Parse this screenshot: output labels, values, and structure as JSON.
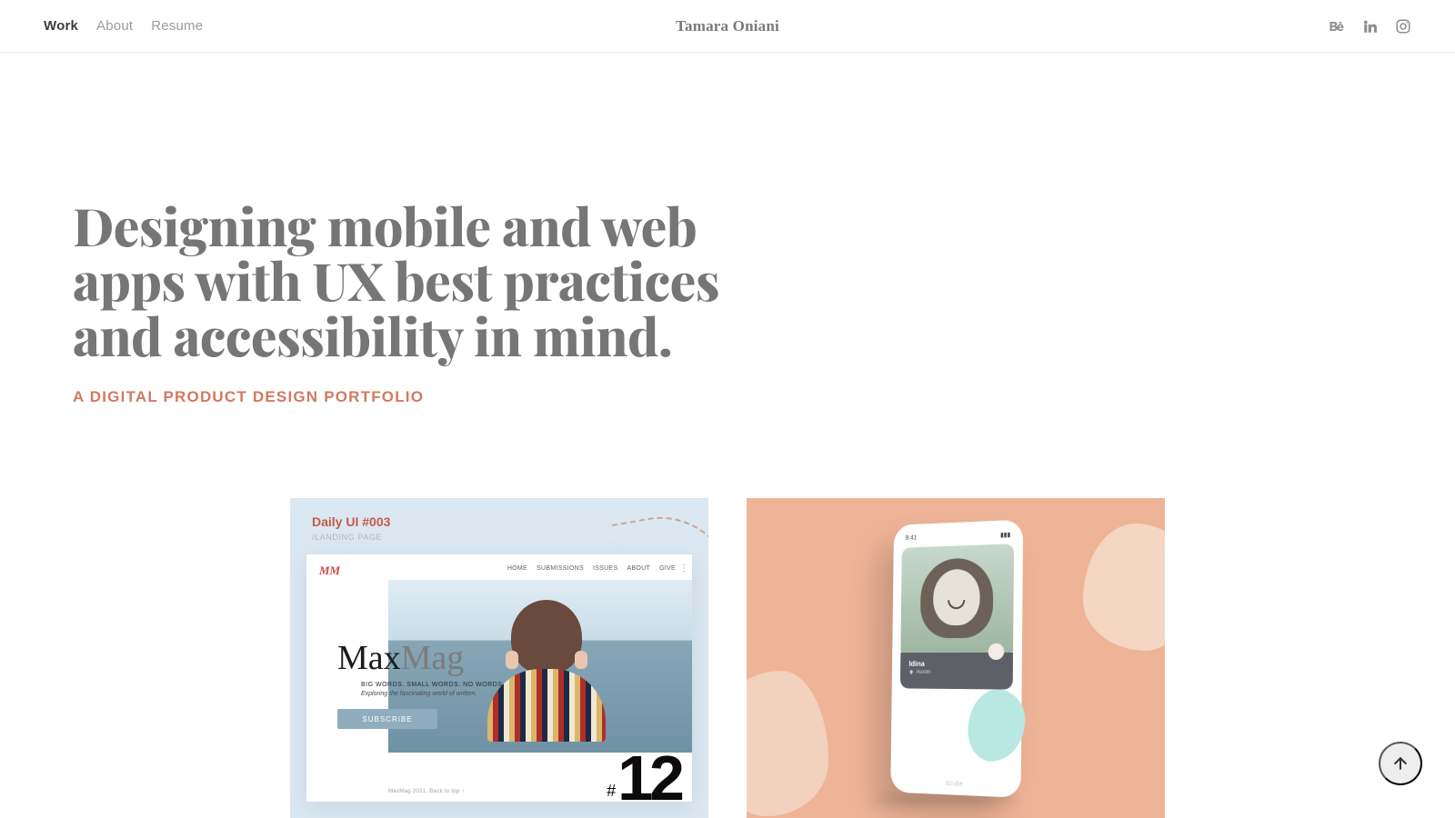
{
  "header": {
    "brand": "Tamara Oniani",
    "nav": [
      {
        "label": "Work",
        "active": true
      },
      {
        "label": "About",
        "active": false
      },
      {
        "label": "Resume",
        "active": false
      }
    ]
  },
  "hero": {
    "headline": "Designing mobile and web apps with UX best practices and accessibility in mind.",
    "subtitle": "A DIGITAL PRODUCT DESIGN PORTFOLIO"
  },
  "card1": {
    "challenge": "Daily UI #003",
    "challenge_sub": "/LANDING PAGE",
    "brand": "MM",
    "menu": [
      "HOME",
      "SUBMISSIONS",
      "ISSUES",
      "ABOUT",
      "GIVE"
    ],
    "title_a": "Max",
    "title_b": "Mag",
    "tagline": "BIG WORDS. SMALL WORDS. NO WORDS.",
    "tagline2": "Exploring the fascinating world of written.",
    "cta": "SUBSCRIBE",
    "footer": "MaxMag 2021. Back to top ↑",
    "number": "12"
  },
  "card2": {
    "status_time": "9:41",
    "name": "Idina",
    "location": "Austin",
    "foot": "Slide"
  },
  "colors": {
    "accent": "#d2795f",
    "text_muted": "#767676"
  }
}
